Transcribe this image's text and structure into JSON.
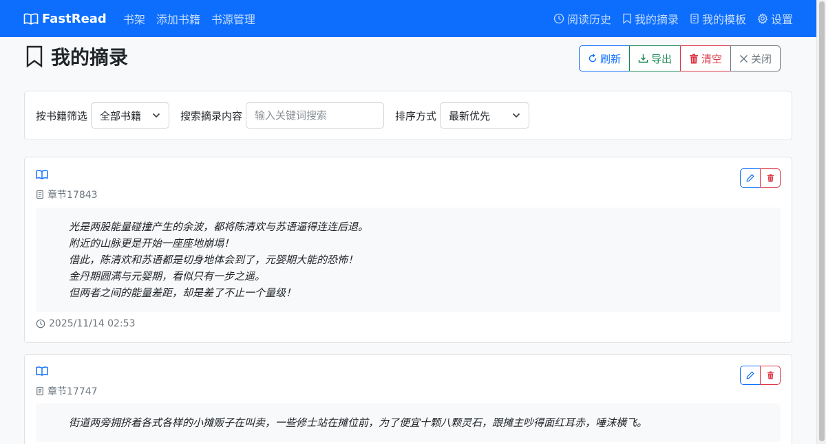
{
  "navbar": {
    "brand": "FastRead",
    "left_links": [
      "书架",
      "添加书籍",
      "书源管理"
    ],
    "right_links": [
      {
        "label": "阅读历史",
        "icon": "clock-icon"
      },
      {
        "label": "我的摘录",
        "icon": "bookmark-icon"
      },
      {
        "label": "我的模板",
        "icon": "file-text-icon"
      },
      {
        "label": "设置",
        "icon": "gear-icon"
      }
    ]
  },
  "page": {
    "title": "我的摘录",
    "actions": {
      "refresh": "刷新",
      "export": "导出",
      "clear": "清空",
      "close": "关闭"
    }
  },
  "filters": {
    "book_label": "按书籍筛选",
    "book_selected": "全部书籍",
    "search_label": "搜索摘录内容",
    "search_placeholder": "输入关键词搜索",
    "search_value": "",
    "sort_label": "排序方式",
    "sort_selected": "最新优先"
  },
  "excerpts": [
    {
      "chapter": "章节17843",
      "lines": [
        "光是两股能量碰撞产生的余波，都将陈清欢与苏语逼得连连后退。",
        "附近的山脉更是开始一座座地崩塌！",
        "借此，陈清欢和苏语都是切身地体会到了，元婴期大能的恐怖！",
        "金丹期圆满与元婴期，看似只有一步之遥。",
        "但两者之间的能量差距，却是差了不止一个量级！"
      ],
      "timestamp": "2025/11/14 02:53"
    },
    {
      "chapter": "章节17747",
      "lines": [
        "街道两旁拥挤着各式各样的小摊贩子在叫卖，一些修士站在摊位前，为了便宜十颗八颗灵石，跟摊主吵得面红耳赤，唾沫横飞。"
      ]
    }
  ],
  "colors": {
    "primary": "#0d6efd",
    "success": "#198754",
    "danger": "#dc3545",
    "secondary": "#6c757d"
  }
}
